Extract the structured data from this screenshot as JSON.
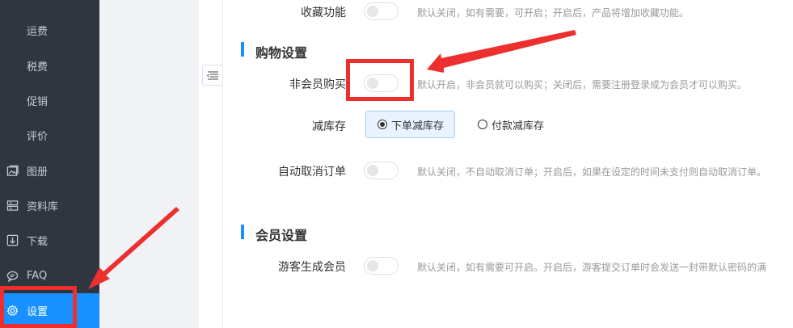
{
  "sidebar": {
    "items": [
      {
        "label": "运费",
        "icon": null
      },
      {
        "label": "税费",
        "icon": null
      },
      {
        "label": "促销",
        "icon": null
      },
      {
        "label": "评价",
        "icon": null
      },
      {
        "label": "图册",
        "icon": "album-icon"
      },
      {
        "label": "资料库",
        "icon": "database-icon"
      },
      {
        "label": "下载",
        "icon": "download-icon"
      },
      {
        "label": "FAQ",
        "icon": "faq-icon"
      },
      {
        "label": "设置",
        "icon": "settings-icon",
        "active": true
      }
    ]
  },
  "settings": {
    "favorites": {
      "label": "收藏功能",
      "enabled": false,
      "desc": "默认关闭，如有需要，可开启；开启后，产品将增加收藏功能。"
    },
    "shopping_section": {
      "title": "购物设置"
    },
    "non_member_purchase": {
      "label": "非会员购买",
      "enabled": false,
      "desc": "默认开启，非会员就可以购买；关闭后，需要注册登录成为会员才可以购买。"
    },
    "reduce_stock": {
      "label": "减库存",
      "options": [
        "下单减库存",
        "付款减库存"
      ],
      "selected": "下单减库存"
    },
    "auto_cancel": {
      "label": "自动取消订单",
      "enabled": false,
      "desc": "默认关闭，不自动取消订单；开启后，如果在设定的时间未支付则自动取消订单。"
    },
    "member_section": {
      "title": "会员设置"
    },
    "guest_member": {
      "label": "游客生成会员",
      "enabled": false,
      "desc": "默认关闭，如有需要可开启。开启后，游客提交订单时会发送一封带默认密码的满"
    }
  },
  "colors": {
    "accent": "#1890ff",
    "sidebar_bg": "#2f3640",
    "annotation_red": "#ee2f2f"
  }
}
